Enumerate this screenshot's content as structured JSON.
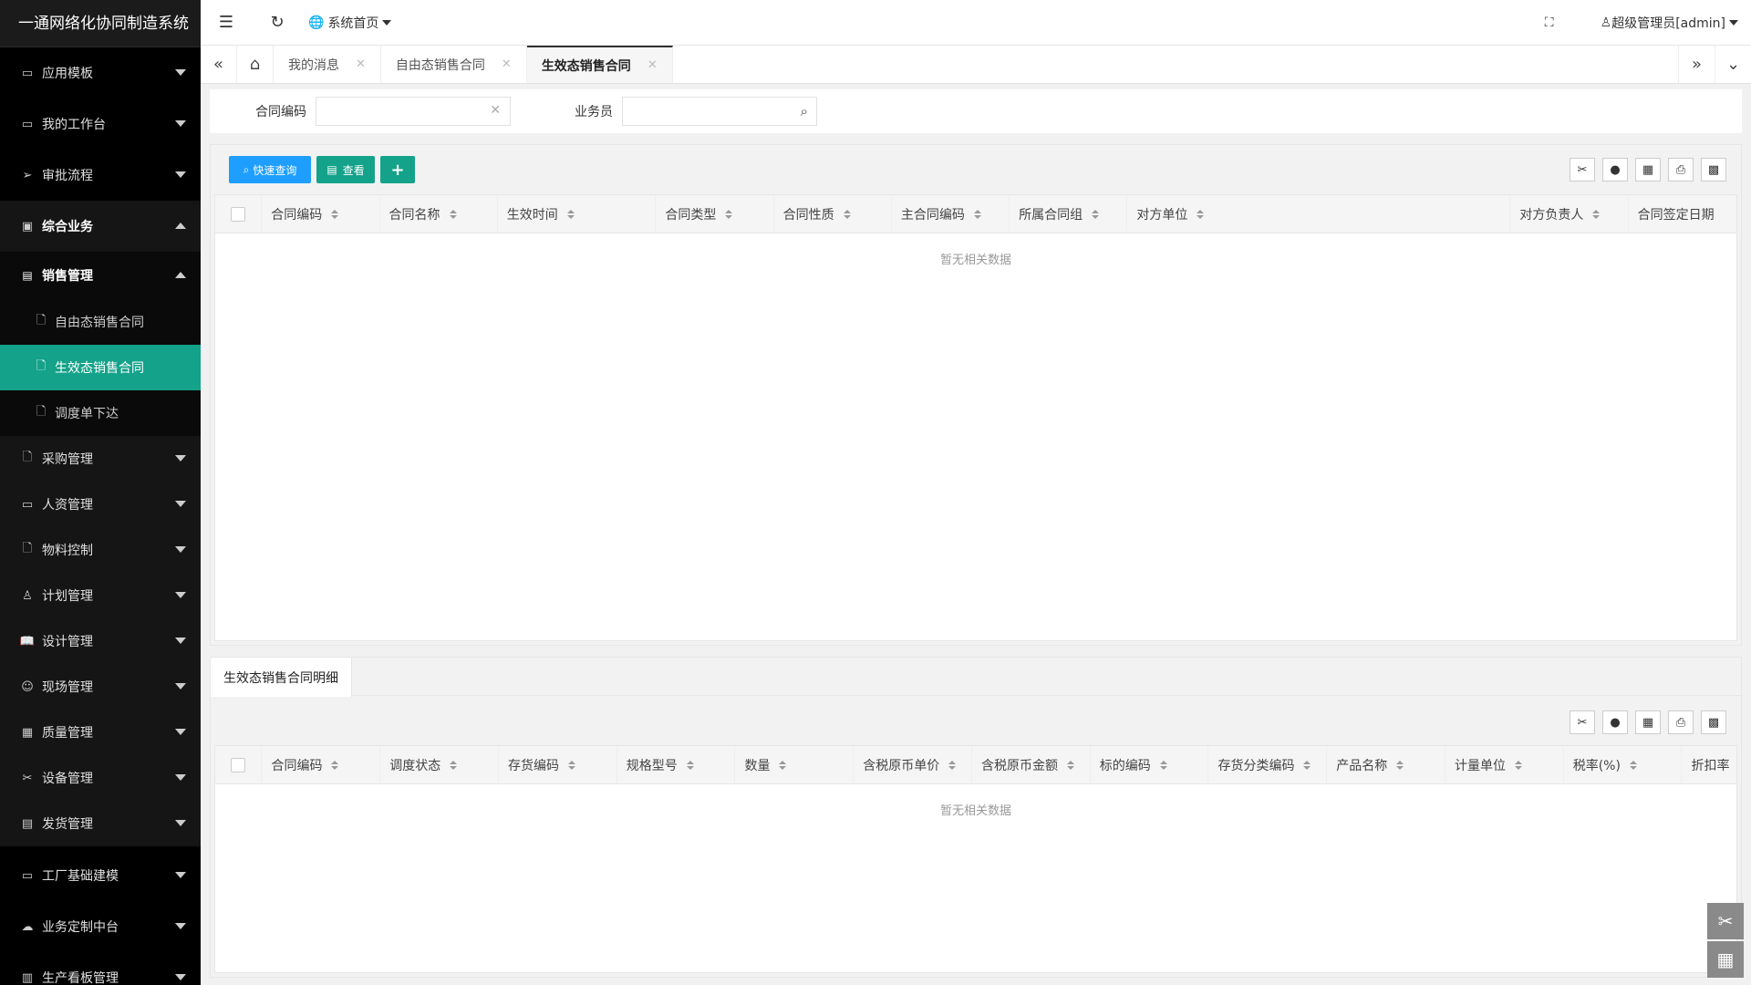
{
  "app": {
    "title": "一通网络化协同制造系统"
  },
  "sidebar": {
    "items_top": [
      {
        "label": "应用模板",
        "icon": "folder-icon"
      },
      {
        "label": "我的工作台",
        "icon": "folder-icon"
      },
      {
        "label": "审批流程",
        "icon": "send-icon"
      },
      {
        "label": "综合业务",
        "icon": "grid-icon"
      }
    ],
    "sales_group": {
      "label": "销售管理",
      "icon": "doc-icon"
    },
    "sales_sub": [
      {
        "label": "自由态销售合同"
      },
      {
        "label": "生效态销售合同"
      },
      {
        "label": "调度单下达"
      }
    ],
    "items_mid": [
      {
        "label": "采购管理"
      },
      {
        "label": "人资管理"
      },
      {
        "label": "物料控制"
      },
      {
        "label": "计划管理"
      },
      {
        "label": "设计管理"
      },
      {
        "label": "现场管理"
      },
      {
        "label": "质量管理"
      },
      {
        "label": "设备管理"
      },
      {
        "label": "发货管理"
      }
    ],
    "items_bottom": [
      {
        "label": "工厂基础建模"
      },
      {
        "label": "业务定制中台"
      },
      {
        "label": "生产看板管理"
      }
    ]
  },
  "topbar": {
    "home_menu": "系统首页",
    "user": "超级管理员[admin]"
  },
  "tabs": [
    {
      "label": "我的消息"
    },
    {
      "label": "自由态销售合同"
    },
    {
      "label": "生效态销售合同"
    }
  ],
  "search": {
    "contract_code_label": "合同编码",
    "salesman_label": "业务员",
    "contract_code_value": "",
    "salesman_value": ""
  },
  "toolbar": {
    "quick_query": "快速查询",
    "view": "查看",
    "add": "+"
  },
  "main_table": {
    "columns": [
      "合同编码",
      "合同名称",
      "生效时间",
      "合同类型",
      "合同性质",
      "主合同编码",
      "所属合同组",
      "对方单位",
      "对方负责人",
      "合同签定日期"
    ],
    "empty_text": "暂无相关数据"
  },
  "detail": {
    "tab_label": "生效态销售合同明细",
    "columns": [
      "合同编码",
      "调度状态",
      "存货编码",
      "规格型号",
      "数量",
      "含税原币单价",
      "含税原币金额",
      "标的编码",
      "存货分类编码",
      "产品名称",
      "计量单位",
      "税率(%)",
      "折扣率"
    ],
    "empty_text": "暂无相关数据"
  }
}
